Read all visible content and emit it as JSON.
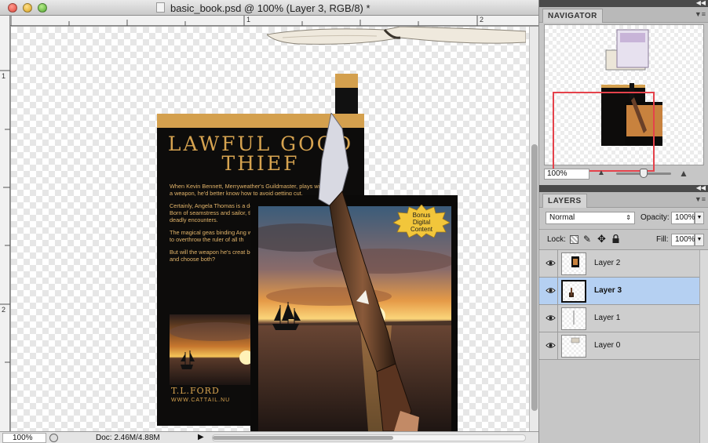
{
  "window": {
    "title": "basic_book.psd @ 100% (Layer 3, RGB/8) *",
    "ruler_top_marks": [
      "1",
      "2"
    ],
    "ruler_left_marks": [
      "1",
      "2"
    ]
  },
  "status": {
    "zoom": "100%",
    "doc_size": "Doc: 2.46M/4.88M"
  },
  "artwork": {
    "back_title_line1": "LAWFUL GOOD",
    "back_title_line2": "THIEF",
    "blurb": [
      "When Kevin Bennett, Merryweather's Guildmaster, plays with a weapon, he'd better know how to avoid getting cut.",
      "Certainly, Angela Thomas is a despite her youth and foolish Born of seamstress and sailor, the world of assassins, hidden deadly encounters.",
      "The magical geas binding Ang will only last so long and Kevi to overthrow the ruler of all th",
      "But will the weapon he's creat between a future of light or d and choose both?"
    ],
    "author": "T.L.FORD",
    "url": "WWW.CATTAIL.NU",
    "badge": "Bonus Digital Content"
  },
  "navigator": {
    "tab": "NAVIGATOR",
    "zoom": "100%"
  },
  "layers_panel": {
    "tab": "LAYERS",
    "blend_mode": "Normal",
    "opacity_label": "Opacity:",
    "opacity_value": "100%",
    "lock_label": "Lock:",
    "fill_label": "Fill:",
    "fill_value": "100%",
    "layers": [
      {
        "name": "Layer 2",
        "selected": false
      },
      {
        "name": "Layer 3",
        "selected": true
      },
      {
        "name": "Layer 1",
        "selected": false
      },
      {
        "name": "Layer 0",
        "selected": false
      }
    ]
  },
  "colors": {
    "accent_gold": "#d4a04e",
    "selection_blue": "#b5d0f2",
    "navigator_frame": "#e5424b"
  }
}
